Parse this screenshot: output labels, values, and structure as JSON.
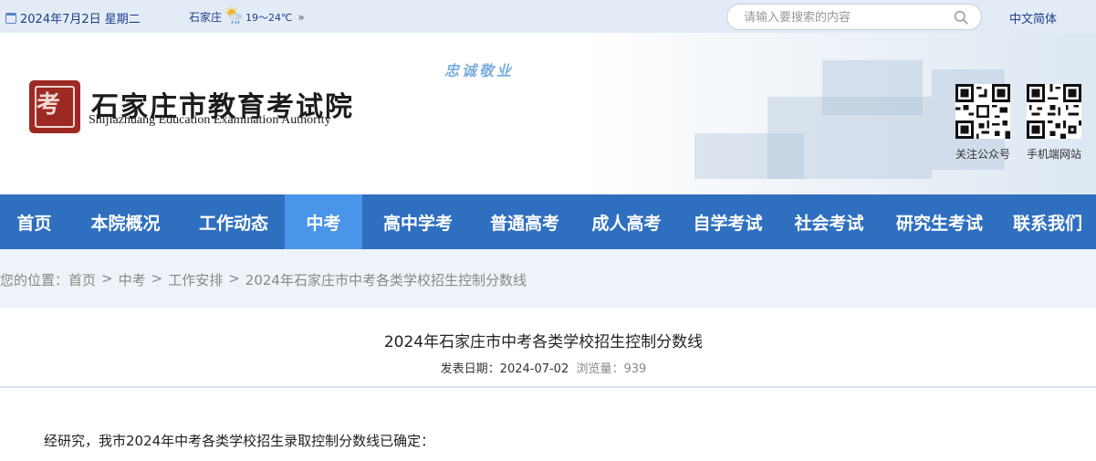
{
  "topbar": {
    "date": "2024年7月2日 星期二",
    "city": "石家庄",
    "temp": "19～24℃",
    "more": "»",
    "search_placeholder": "请输入要搜索的内容",
    "lang": "中文简体"
  },
  "header": {
    "slogan": "忠诚敬业",
    "seal_glyph": "考",
    "org_cn": "石家庄市教育考试院",
    "org_en": "Shijiazhuang Education Examination Authority",
    "qr": [
      {
        "label": "关注公众号"
      },
      {
        "label": "手机端网站"
      }
    ]
  },
  "nav": {
    "items": [
      {
        "label": "首页"
      },
      {
        "label": "本院概况"
      },
      {
        "label": "工作动态"
      },
      {
        "label": "中考",
        "active": true
      },
      {
        "label": "高中学考"
      },
      {
        "label": "普通高考"
      },
      {
        "label": "成人高考"
      },
      {
        "label": "自学考试"
      },
      {
        "label": "社会考试"
      },
      {
        "label": "研究生考试"
      },
      {
        "label": "联系我们"
      }
    ]
  },
  "breadcrumb": {
    "prefix": "您的位置：",
    "items": [
      "首页",
      "中考",
      "工作安排",
      "2024年石家庄市中考各类学校招生控制分数线"
    ],
    "separator": ">"
  },
  "article": {
    "title": "2024年石家庄市中考各类学校招生控制分数线",
    "date_label": "发表日期：",
    "date": "2024-07-02",
    "views_label": "浏览量：",
    "views": "939",
    "first_paragraph": "经研究，我市2024年中考各类学校招生录取控制分数线已确定："
  },
  "colors": {
    "nav_bg": "#2f6fbf",
    "nav_active": "#4a95ea",
    "topbar_bg": "#e3ecf6",
    "seal": "#9c2a22"
  }
}
